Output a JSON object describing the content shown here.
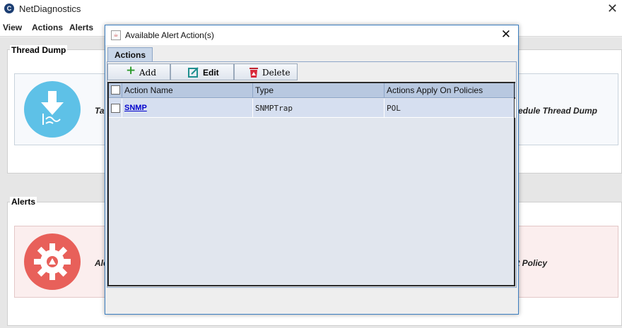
{
  "app": {
    "title": "NetDiagnostics",
    "close_glyph": "✕"
  },
  "menu": [
    "View",
    "Actions",
    "Alerts"
  ],
  "sections": {
    "thread_dump": {
      "title": "Thread Dump",
      "left_card_text": "Ta",
      "right_card_text": "edule Thread Dump",
      "accent": "#5ec1e7"
    },
    "alerts": {
      "title": "Alerts",
      "left_card_text": "Ale",
      "right_card_text": "ert Policy",
      "accent": "#e8605a"
    }
  },
  "dialog": {
    "title": "Available Alert Action(s)",
    "close_glyph": "✕",
    "tab_label": "Actions",
    "toolbar": {
      "add_label": "Add",
      "edit_label": "Edit",
      "delete_label": "Delete"
    },
    "table": {
      "columns": [
        "Action Name",
        "Type",
        "Actions Apply On Policies"
      ],
      "rows": [
        {
          "name": "SNMP",
          "type": "SNMPTrap",
          "policies": "POL",
          "checked": false
        }
      ]
    }
  },
  "icons": {
    "thread_dump_card": "download-icon",
    "alerts_card": "gear-warning-icon",
    "add": "plus-icon",
    "edit": "edit-icon",
    "delete": "trash-icon"
  }
}
